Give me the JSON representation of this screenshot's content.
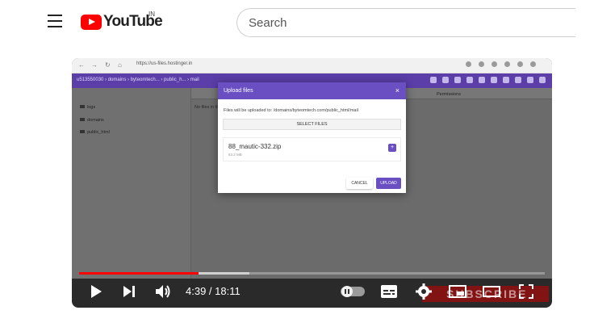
{
  "header": {
    "logo_text": "YouTube",
    "region": "IN",
    "search_placeholder": "Search"
  },
  "browser": {
    "address": "https://us-files.hostinger.in"
  },
  "file_manager": {
    "breadcrumb": "u513550030  ›  domains  ›  byteomtech...  ›  public_h...  ›  mail",
    "tree": [
      "logs",
      "domains",
      "public_html"
    ],
    "permissions_header": "Permissions",
    "empty_text": "No files in this directory"
  },
  "modal": {
    "title": "Upload files",
    "close": "×",
    "note": "Files will be uploaded to: /domains/byteomtech.com/public_html/mail",
    "select_files": "SELECT FILES",
    "file": {
      "name": "88_mautic-332.zip",
      "size": "63.2 MB"
    },
    "add": "+",
    "cancel": "CANCEL",
    "upload": "UPLOAD"
  },
  "player": {
    "time": "4:39 / 18:11",
    "progress_played": 0.256,
    "progress_buffered": 0.365,
    "subscribe_watermark": "SUBSCRIBE",
    "colors": {
      "played": "#ff0000",
      "accent": "#6a4fc2"
    }
  }
}
